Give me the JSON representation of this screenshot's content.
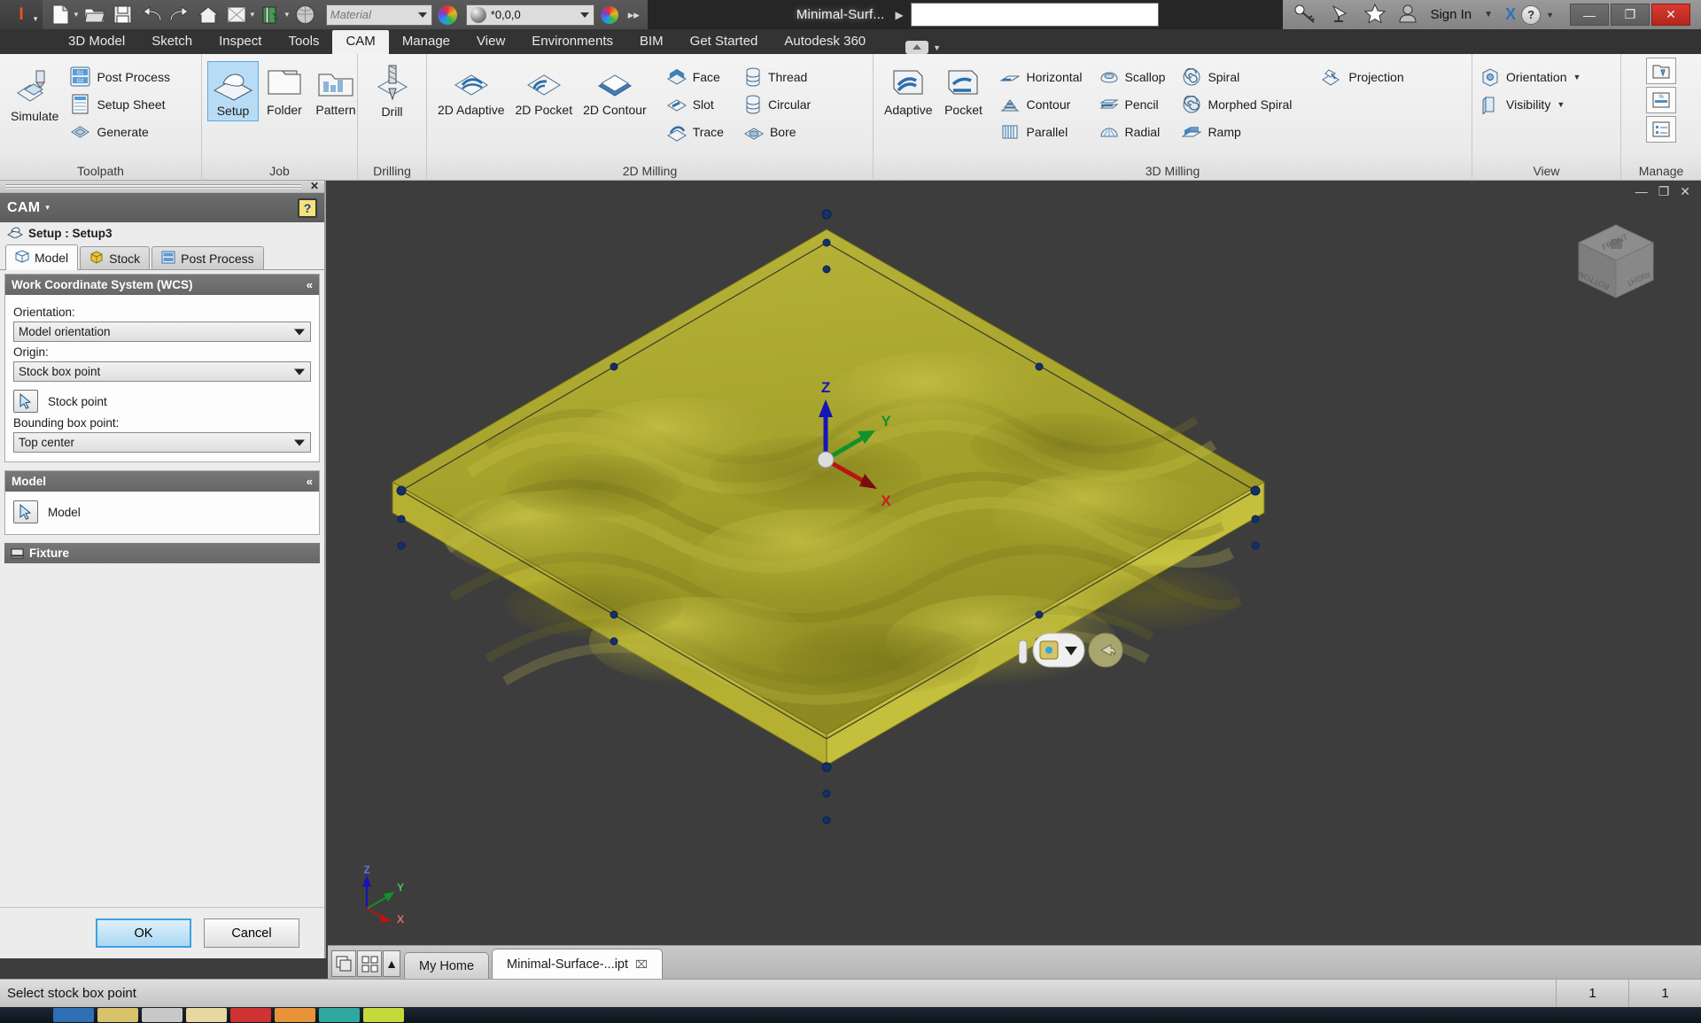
{
  "titlebar": {
    "app_button": "I",
    "quick_access": [
      {
        "name": "new-file-icon",
        "label": "New"
      },
      {
        "name": "open-file-icon",
        "label": "Open"
      },
      {
        "name": "save-icon",
        "label": "Save"
      },
      {
        "name": "undo-icon",
        "label": "Undo"
      },
      {
        "name": "redo-icon",
        "label": "Redo"
      },
      {
        "name": "home-icon",
        "label": "Home"
      },
      {
        "name": "parameters-icon",
        "label": "Parameters"
      },
      {
        "name": "material-browser-icon",
        "label": "Material Browser"
      },
      {
        "name": "appearance-sphere-icon",
        "label": "Appearance"
      }
    ],
    "material_value": "",
    "material_placeholder": "Material",
    "appearance_value": "*0,0,0",
    "expand_chevron": "▸▸",
    "document_tab": "Minimal-Surf...",
    "document_tab_arrow": "▶",
    "search_value": "",
    "search_placeholder": "",
    "sign_in": "Sign In",
    "right_icons": [
      "key-icon",
      "satellite-icon",
      "star-icon",
      "user-icon"
    ],
    "exchange_label": "X",
    "help_label": "?",
    "window_controls": {
      "minimize": "—",
      "maximize": "❐",
      "close": "✕"
    }
  },
  "ribbon": {
    "tabs": [
      {
        "label": "3D Model",
        "active": false
      },
      {
        "label": "Sketch",
        "active": false
      },
      {
        "label": "Inspect",
        "active": false
      },
      {
        "label": "Tools",
        "active": false
      },
      {
        "label": "CAM",
        "active": true
      },
      {
        "label": "Manage",
        "active": false
      },
      {
        "label": "View",
        "active": false
      },
      {
        "label": "Environments",
        "active": false
      },
      {
        "label": "BIM",
        "active": false
      },
      {
        "label": "Get Started",
        "active": false
      },
      {
        "label": "Autodesk 360",
        "active": false
      }
    ],
    "panels": [
      {
        "title": "Toolpath",
        "big": [
          {
            "label": "Simulate",
            "icon": "simulate-icon"
          }
        ],
        "small": [
          {
            "label": "Post Process",
            "icon": "post-process-icon"
          },
          {
            "label": "Setup Sheet",
            "icon": "setup-sheet-icon"
          },
          {
            "label": "Generate",
            "icon": "generate-icon"
          }
        ]
      },
      {
        "title": "Job",
        "big": [
          {
            "label": "Setup",
            "icon": "setup-icon",
            "selected": true
          },
          {
            "label": "Folder",
            "icon": "folder-icon"
          },
          {
            "label": "Pattern",
            "icon": "pattern-icon"
          }
        ],
        "small": []
      },
      {
        "title": "Drilling",
        "big": [
          {
            "label": "Drill",
            "icon": "drill-icon"
          }
        ],
        "small": []
      },
      {
        "title": "2D Milling",
        "big": [
          {
            "label": "2D Adaptive",
            "icon": "adaptive2d-icon"
          },
          {
            "label": "2D Pocket",
            "icon": "pocket2d-icon"
          },
          {
            "label": "2D Contour",
            "icon": "contour2d-icon"
          }
        ],
        "small": [
          {
            "label": "Face",
            "icon": "face-icon"
          },
          {
            "label": "Slot",
            "icon": "slot-icon"
          },
          {
            "label": "Trace",
            "icon": "trace-icon"
          }
        ],
        "small2": [
          {
            "label": "Thread",
            "icon": "thread-icon"
          },
          {
            "label": "Circular",
            "icon": "circular-icon"
          },
          {
            "label": "Bore",
            "icon": "bore-icon"
          }
        ]
      },
      {
        "title": "3D Milling",
        "big": [
          {
            "label": "Adaptive",
            "icon": "adaptive3d-icon"
          },
          {
            "label": "Pocket",
            "icon": "pocket3d-icon"
          }
        ],
        "small": [
          {
            "label": "Horizontal",
            "icon": "horizontal-icon"
          },
          {
            "label": "Contour",
            "icon": "contour3d-icon"
          },
          {
            "label": "Parallel",
            "icon": "parallel-icon"
          }
        ],
        "small2": [
          {
            "label": "Scallop",
            "icon": "scallop-icon"
          },
          {
            "label": "Pencil",
            "icon": "pencil-icon"
          },
          {
            "label": "Radial",
            "icon": "radial-icon"
          }
        ],
        "small3": [
          {
            "label": "Spiral",
            "icon": "spiral-icon"
          },
          {
            "label": "Morphed Spiral",
            "icon": "morphed-spiral-icon"
          },
          {
            "label": "Ramp",
            "icon": "ramp-icon"
          }
        ],
        "small4": [
          {
            "label": "Projection",
            "icon": "projection-icon"
          }
        ]
      },
      {
        "title": "View",
        "small": [
          {
            "label": "Orientation",
            "icon": "orientation-icon",
            "dropdown": true
          },
          {
            "label": "Visibility",
            "icon": "visibility-icon",
            "dropdown": true
          }
        ]
      },
      {
        "title": "Manage",
        "stack": [
          {
            "icon": "tool-library-icon"
          },
          {
            "icon": "machine-icon"
          },
          {
            "icon": "template-icon"
          }
        ]
      }
    ]
  },
  "cam_dialog": {
    "title": "CAM",
    "title_caret": "▾",
    "help_glyph": "?",
    "close_glyph": "✕",
    "setup_label": "Setup : Setup3",
    "tabs": [
      {
        "label": "Model",
        "icon": "model-tab-icon",
        "active": true
      },
      {
        "label": "Stock",
        "icon": "stock-tab-icon",
        "active": false
      },
      {
        "label": "Post Process",
        "icon": "post-tab-icon",
        "active": false
      }
    ],
    "groups": [
      {
        "name": "wcs",
        "header": "Work Coordinate System (WCS)",
        "collapse_glyph": "«",
        "fields": [
          {
            "type": "combo",
            "label": "Orientation:",
            "value": "Model orientation"
          },
          {
            "type": "combo",
            "label": "Origin:",
            "value": "Stock box point"
          },
          {
            "type": "select",
            "label": "Stock point",
            "icon": "pick-cursor-icon"
          },
          {
            "type": "combo",
            "label": "Bounding box point:",
            "value": "Top center"
          }
        ]
      },
      {
        "name": "model",
        "header": "Model",
        "collapse_glyph": "«",
        "fields": [
          {
            "type": "select",
            "label": "Model",
            "icon": "pick-cursor-icon"
          }
        ]
      },
      {
        "name": "fixture",
        "header": "Fixture",
        "icon": "fixture-icon",
        "collapsed": true,
        "fields": []
      }
    ],
    "ok_label": "OK",
    "cancel_label": "Cancel"
  },
  "viewport": {
    "window_buttons": {
      "minimize": "—",
      "restore": "❐",
      "close": "✕"
    },
    "viewcube_faces": {
      "top": "FRONT",
      "left": "BOTTOM",
      "right": "RIGHT"
    },
    "triad_axes": {
      "x": "X",
      "y": "Y",
      "z": "Z"
    },
    "wcs_axes": {
      "x": "X",
      "y": "Y",
      "z": "Z"
    },
    "model_color": "#adaa2f",
    "background_color": "#3d3d3d",
    "hud": {
      "orbit_icon": "orbit-cube-icon",
      "caret": "▼",
      "back_icon": "back-arrow-icon"
    }
  },
  "document_bar": {
    "view_icons": [
      "tile-windows-icon",
      "arrange-icon"
    ],
    "scroll_up_glyph": "▲",
    "tabs": [
      {
        "label": "My Home",
        "active": false,
        "closable": false
      },
      {
        "label": "Minimal-Surface-...ipt",
        "active": true,
        "closable": true,
        "close_glyph": "⌧"
      }
    ]
  },
  "statusbar": {
    "message": "Select stock box point",
    "cells": [
      "1",
      "1"
    ]
  },
  "taskbar": {
    "items": [
      "#2f6fb5",
      "#d8c36a",
      "#c8c8c8",
      "#e8d7a0",
      "#cf3232",
      "#e8923a",
      "#2fa8a0",
      "#c6d93a"
    ]
  }
}
